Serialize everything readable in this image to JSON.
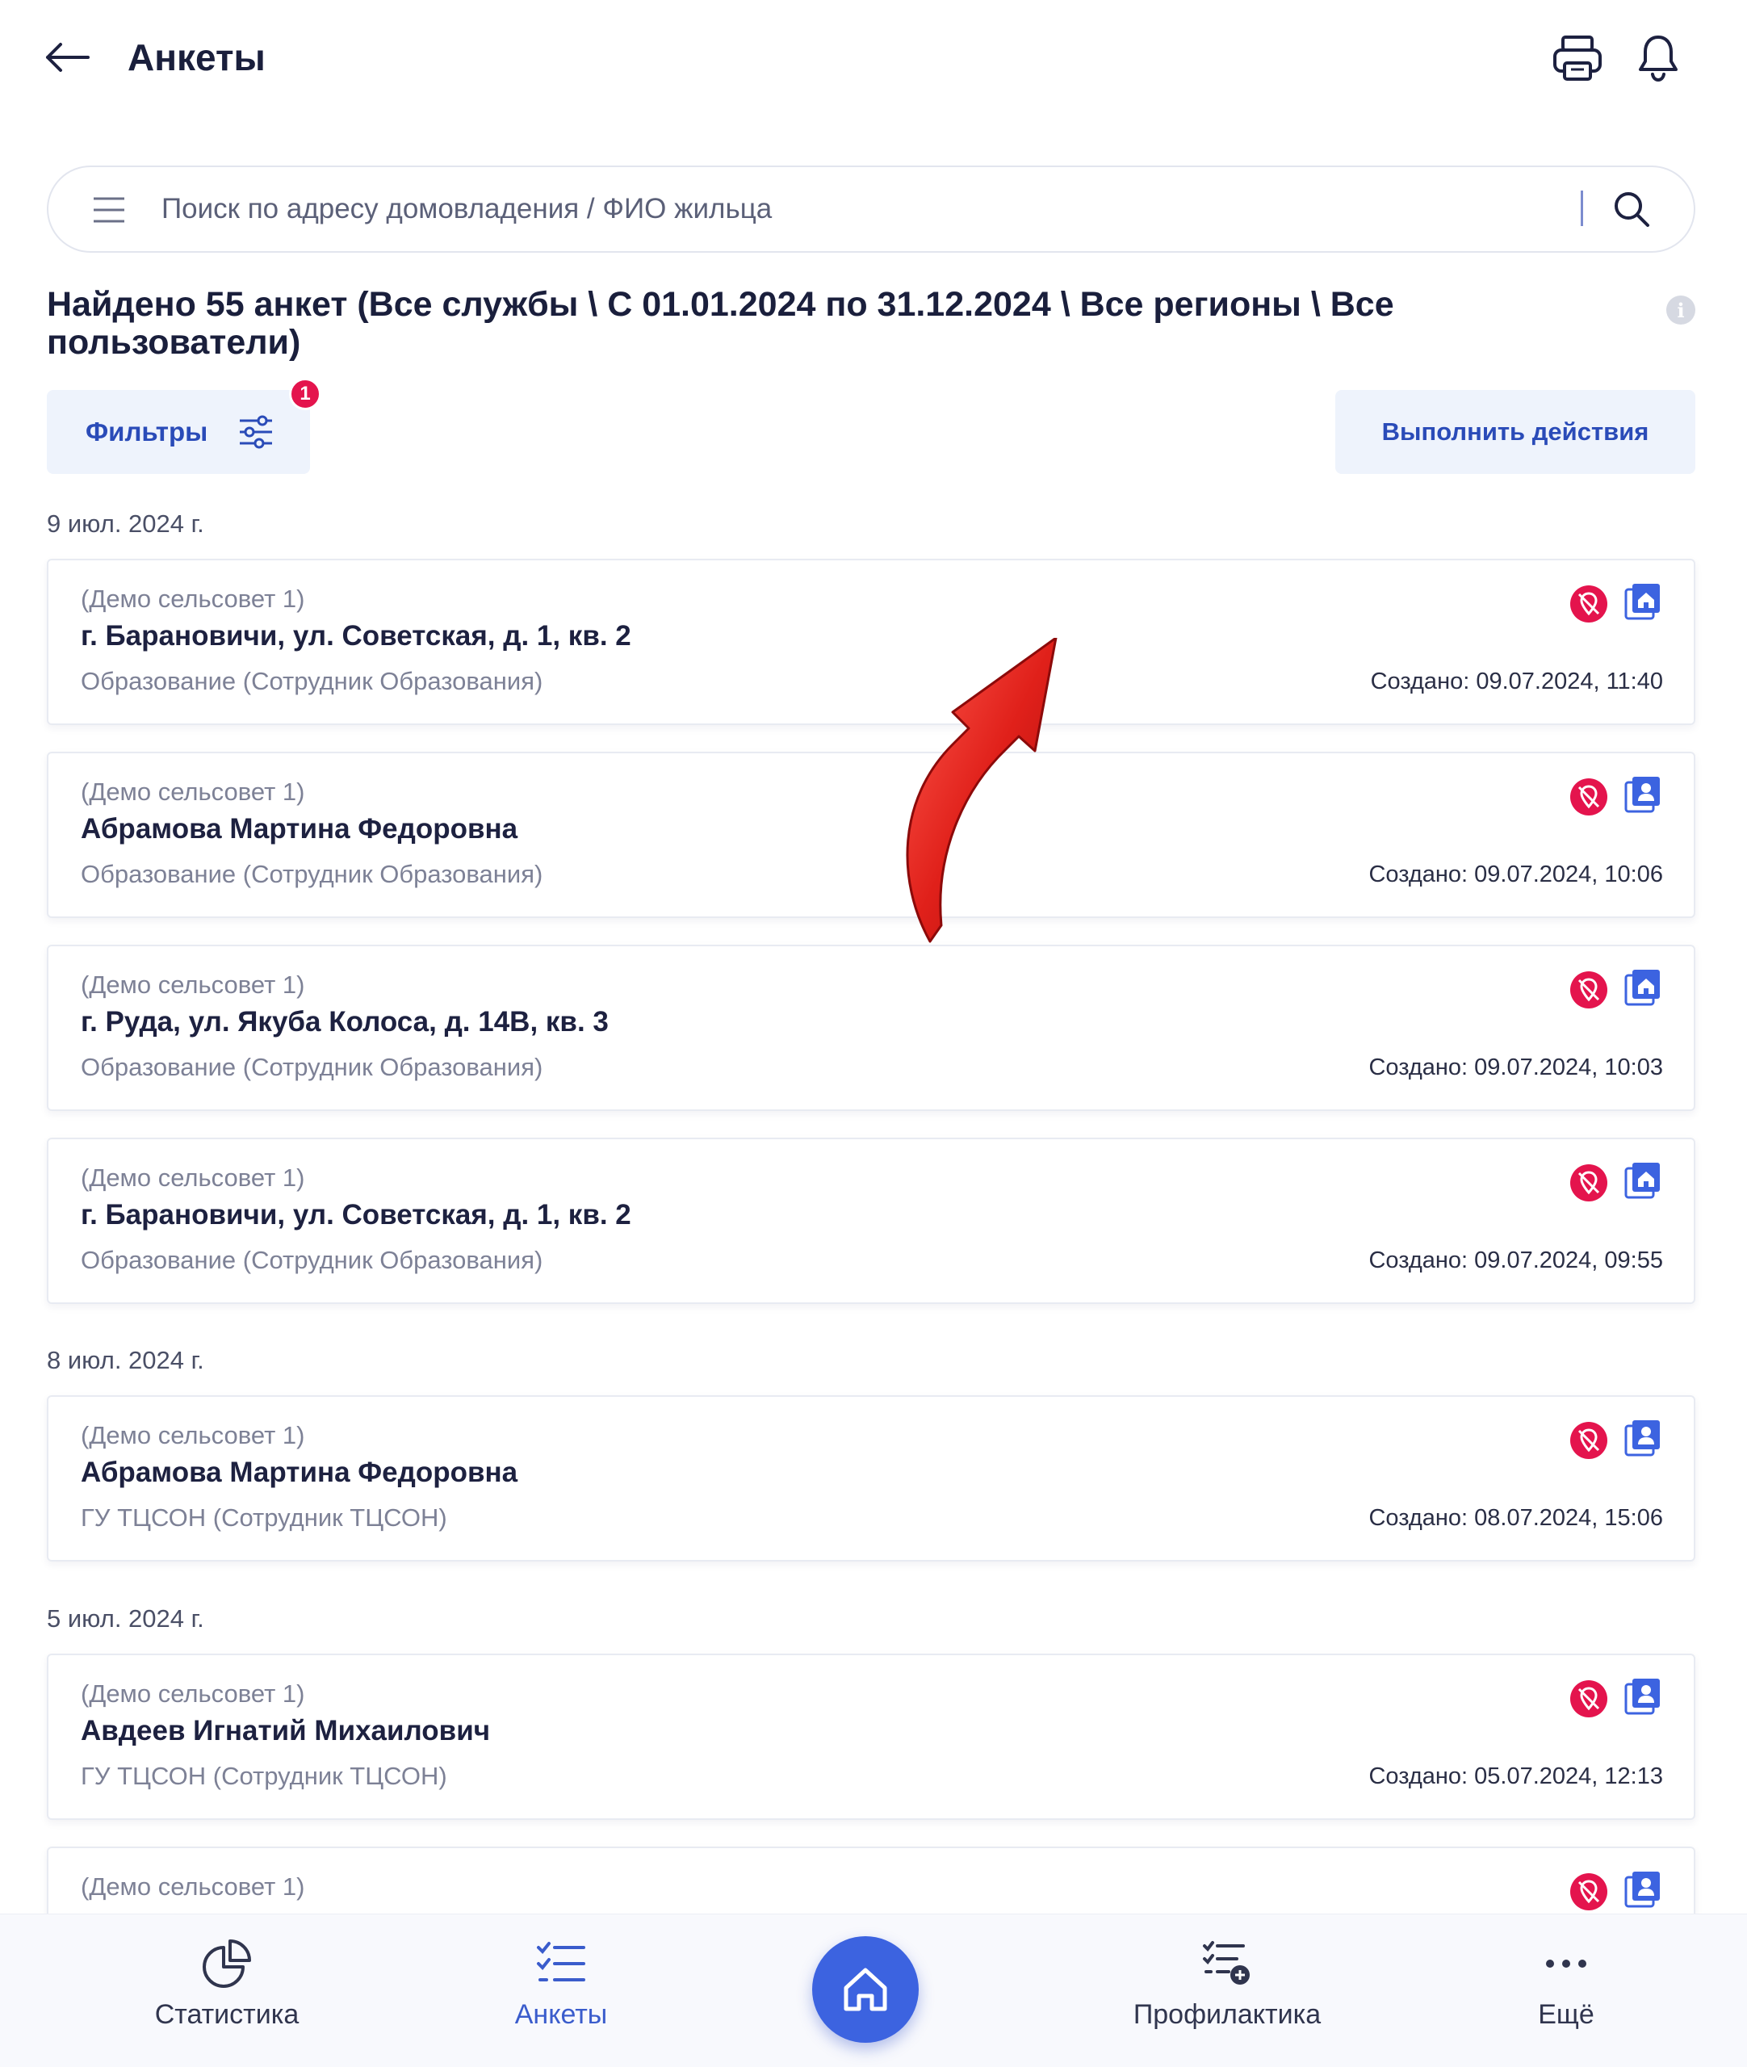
{
  "header": {
    "title": "Анкеты",
    "back_icon": "arrow-left-icon",
    "print_icon": "printer-icon",
    "bell_icon": "bell-icon"
  },
  "search": {
    "placeholder": "Поиск по адресу домовладения / ФИО жильца",
    "value": ""
  },
  "results": {
    "summary": "Найдено 55 анкет (Все службы \\ С 01.01.2024 по 31.12.2024 \\ Все регионы \\ Все пользователи)"
  },
  "toolbar": {
    "filters_label": "Фильтры",
    "filters_badge": "1",
    "actions_label": "Выполнить действия"
  },
  "groups": [
    {
      "date": "9 июл. 2024 г.",
      "cards": [
        {
          "org": "(Демо сельсовет 1)",
          "title": "г. Барановичи, ул. Советская, д. 1, кв. 2",
          "service": "Образование (Сотрудник Образования)",
          "created": "Создано: 09.07.2024, 11:40",
          "type_icon": "house-book-icon"
        },
        {
          "org": "(Демо сельсовет 1)",
          "title": "Абрамова Мартина Федоровна",
          "service": "Образование (Сотрудник Образования)",
          "created": "Создано: 09.07.2024, 10:06",
          "type_icon": "person-book-icon"
        },
        {
          "org": "(Демо сельсовет 1)",
          "title": "г. Руда, ул. Якуба Колоса, д. 14В, кв. 3",
          "service": "Образование (Сотрудник Образования)",
          "created": "Создано: 09.07.2024, 10:03",
          "type_icon": "house-book-icon"
        },
        {
          "org": "(Демо сельсовет 1)",
          "title": "г. Барановичи, ул. Советская, д. 1, кв. 2",
          "service": "Образование (Сотрудник Образования)",
          "created": "Создано: 09.07.2024, 09:55",
          "type_icon": "house-book-icon"
        }
      ]
    },
    {
      "date": "8 июл. 2024 г.",
      "cards": [
        {
          "org": "(Демо сельсовет 1)",
          "title": "Абрамова Мартина Федоровна",
          "service": "ГУ ТЦСОН (Сотрудник ТЦСОН)",
          "created": "Создано: 08.07.2024, 15:06",
          "type_icon": "person-book-icon"
        }
      ]
    },
    {
      "date": "5 июл. 2024 г.",
      "cards": [
        {
          "org": "(Демо сельсовет 1)",
          "title": "Авдеев Игнатий Михаилович",
          "service": "ГУ ТЦСОН (Сотрудник ТЦСОН)",
          "created": "Создано: 05.07.2024, 12:13",
          "type_icon": "person-book-icon"
        },
        {
          "org": "(Демо сельсовет 1)",
          "title": "",
          "service": "",
          "created": "",
          "type_icon": "person-book-icon"
        }
      ]
    }
  ],
  "nav": {
    "items": [
      {
        "label": "Статистика",
        "icon": "pie-chart-icon"
      },
      {
        "label": "Анкеты",
        "icon": "checklist-icon",
        "active": true
      },
      {
        "label": "",
        "icon": "home-icon"
      },
      {
        "label": "Профилактика",
        "icon": "checklist-add-icon"
      },
      {
        "label": "Ещё",
        "icon": "more-dots-icon"
      }
    ]
  },
  "colors": {
    "accent": "#3c63e0",
    "accent_text": "#2a4bb8",
    "badge": "#e4144d",
    "button_bg": "#eef3fc"
  }
}
